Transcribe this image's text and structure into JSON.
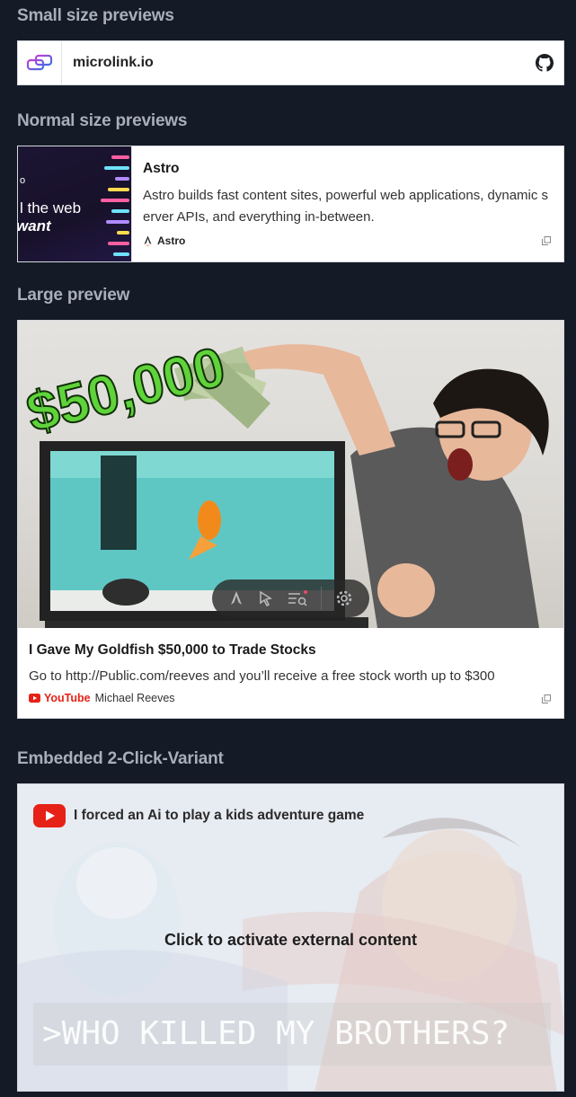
{
  "sections": {
    "small": "Small size previews",
    "normal": "Normal size previews",
    "large": "Large preview",
    "embed": "Embedded 2-Click-Variant"
  },
  "small_preview": {
    "title": "microlink.io",
    "logo_icon": "microlink-logo-icon",
    "action_icon": "github-icon"
  },
  "normal_preview": {
    "title": "Astro",
    "description": "Astro builds fast content sites, powerful web applications, dynamic server APIs, and everything in-between.",
    "publisher": "Astro",
    "thumb_line0": "o",
    "thumb_line1": "l the web",
    "thumb_line2": "want"
  },
  "large_preview": {
    "title": "I Gave My Goldfish $50,000 to Trade Stocks",
    "description": "Go to http://Public.com/reeves and you’ll receive a free stock worth up to $300",
    "publisher": "YouTube",
    "author": "Michael Reeves",
    "image_text": "$50,000"
  },
  "embed": {
    "title": "I forced an Ai to play a kids adventure game",
    "cta": "Click to activate external content",
    "code_text": ">WHO KILLED MY BROTHERS?"
  },
  "colors": {
    "background": "#151b26",
    "heading": "#a9afba",
    "youtube_red": "#e62117",
    "money_green": "#5fd33a"
  }
}
